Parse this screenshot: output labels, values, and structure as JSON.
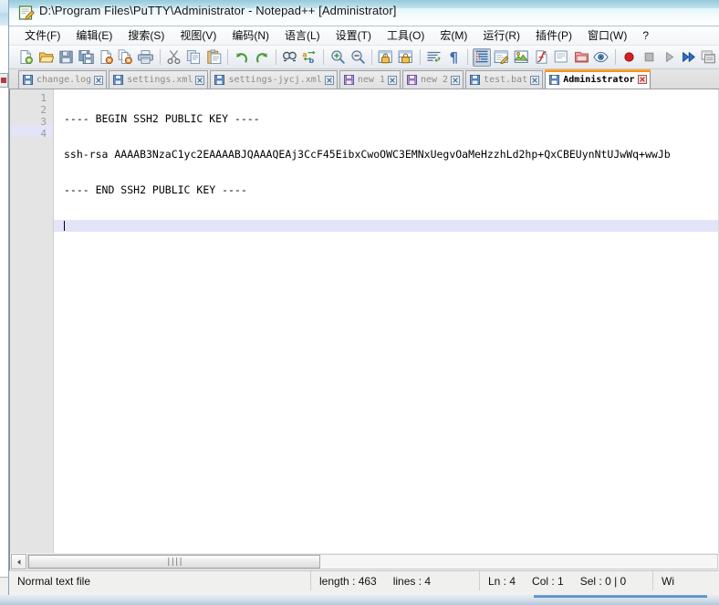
{
  "window": {
    "title": "D:\\Program Files\\PuTTY\\Administrator - Notepad++ [Administrator]",
    "app_icon": "notepad-plus-plus-icon"
  },
  "menubar": {
    "items": [
      {
        "label": "文件(F)",
        "name": "menu-file"
      },
      {
        "label": "编辑(E)",
        "name": "menu-edit"
      },
      {
        "label": "搜索(S)",
        "name": "menu-search"
      },
      {
        "label": "视图(V)",
        "name": "menu-view"
      },
      {
        "label": "编码(N)",
        "name": "menu-encoding"
      },
      {
        "label": "语言(L)",
        "name": "menu-language"
      },
      {
        "label": "设置(T)",
        "name": "menu-settings"
      },
      {
        "label": "工具(O)",
        "name": "menu-tools"
      },
      {
        "label": "宏(M)",
        "name": "menu-macro"
      },
      {
        "label": "运行(R)",
        "name": "menu-run"
      },
      {
        "label": "插件(P)",
        "name": "menu-plugins"
      },
      {
        "label": "窗口(W)",
        "name": "menu-window"
      },
      {
        "label": "?",
        "name": "menu-help"
      }
    ]
  },
  "toolbar": {
    "buttons": [
      {
        "name": "new-file-icon",
        "tip": "新建"
      },
      {
        "name": "open-file-icon",
        "tip": "打开"
      },
      {
        "name": "save-icon",
        "tip": "保存"
      },
      {
        "name": "save-all-icon",
        "tip": "保存所有"
      },
      {
        "name": "close-file-icon",
        "tip": "关闭"
      },
      {
        "name": "close-all-files-icon",
        "tip": "关闭所有"
      },
      {
        "name": "print-icon",
        "tip": "打印"
      },
      {
        "name": "separator-1"
      },
      {
        "name": "cut-icon",
        "tip": "剪切"
      },
      {
        "name": "copy-icon",
        "tip": "复制"
      },
      {
        "name": "paste-icon",
        "tip": "粘贴"
      },
      {
        "name": "separator-2"
      },
      {
        "name": "undo-icon",
        "tip": "撤销"
      },
      {
        "name": "redo-icon",
        "tip": "重做"
      },
      {
        "name": "separator-3"
      },
      {
        "name": "find-icon",
        "tip": "查找"
      },
      {
        "name": "replace-icon",
        "tip": "替换"
      },
      {
        "name": "separator-4"
      },
      {
        "name": "zoom-in-icon",
        "tip": "放大"
      },
      {
        "name": "zoom-out-icon",
        "tip": "缩小"
      },
      {
        "name": "separator-5"
      },
      {
        "name": "sync-vertical-scroll-icon",
        "tip": "同步垂直滚动"
      },
      {
        "name": "sync-horizontal-scroll-icon",
        "tip": "同步水平滚动"
      },
      {
        "name": "separator-6"
      },
      {
        "name": "word-wrap-icon",
        "tip": "自动换行"
      },
      {
        "name": "show-all-characters-icon",
        "tip": "显示所有字符"
      },
      {
        "name": "separator-7"
      },
      {
        "name": "indent-guide-icon",
        "tip": "缩进参考线",
        "pressed": true
      },
      {
        "name": "user-defined-language-icon",
        "tip": "用户自定义语言"
      },
      {
        "name": "document-map-icon",
        "tip": "文档地图"
      },
      {
        "name": "function-list-icon",
        "tip": "函数列表"
      },
      {
        "name": "document-switcher-icon",
        "tip": "文档列表"
      },
      {
        "name": "folder-as-workspace-icon",
        "tip": "文件夹作为工作区"
      },
      {
        "name": "monitoring-icon",
        "tip": "监视文件"
      },
      {
        "name": "separator-8"
      },
      {
        "name": "macro-record-icon",
        "tip": "开始录制"
      },
      {
        "name": "macro-stop-icon",
        "tip": "停止录制"
      },
      {
        "name": "macro-play-icon",
        "tip": "播放"
      },
      {
        "name": "macro-play-multiple-icon",
        "tip": "多次运行宏"
      },
      {
        "name": "macro-save-icon",
        "tip": "保存当前录制的宏"
      }
    ]
  },
  "tabs": [
    {
      "label": "change.log",
      "name": "tab-change-log",
      "active": false
    },
    {
      "label": "settings.xml",
      "name": "tab-settings-xml",
      "active": false
    },
    {
      "label": "settings-jycj.xml",
      "name": "tab-settings-jycj-xml",
      "active": false
    },
    {
      "label": "new 1",
      "name": "tab-new-1",
      "active": false
    },
    {
      "label": "new 2",
      "name": "tab-new-2",
      "active": false
    },
    {
      "label": "test.bat",
      "name": "tab-test-bat",
      "active": false
    },
    {
      "label": "Administrator",
      "name": "tab-administrator",
      "active": true
    }
  ],
  "editor": {
    "line_numbers": [
      "1",
      "2",
      "3",
      "4"
    ],
    "lines": [
      "---- BEGIN SSH2 PUBLIC KEY ----",
      "ssh-rsa AAAAB3NzaC1yc2EAAAABJQAAAQEAj3CcF45EibxCwoOWC3EMNxUegvOaMeHzzhLd2hp+QxCBEUynNtUJwWq+wwJb",
      "---- END SSH2 PUBLIC KEY ----",
      ""
    ],
    "current_line_index": 3,
    "current_line_highlight": "#e4e4f8"
  },
  "hscroll": {
    "left_arrow": "scroll-left-arrow-icon",
    "grip": "||||"
  },
  "statusbar": {
    "file_type": "Normal text file",
    "length_label": "length : 463",
    "lines_label": "lines : 4",
    "ln_label": "Ln : 4",
    "col_label": "Col : 1",
    "sel_label": "Sel : 0 | 0",
    "eol_label": "Wi"
  },
  "colors": {
    "active_tab_accent": "#f08c14",
    "current_line": "#e4e4f8",
    "gutter_bg": "#e4e4e4",
    "titlebar": "#d8f0f6"
  }
}
